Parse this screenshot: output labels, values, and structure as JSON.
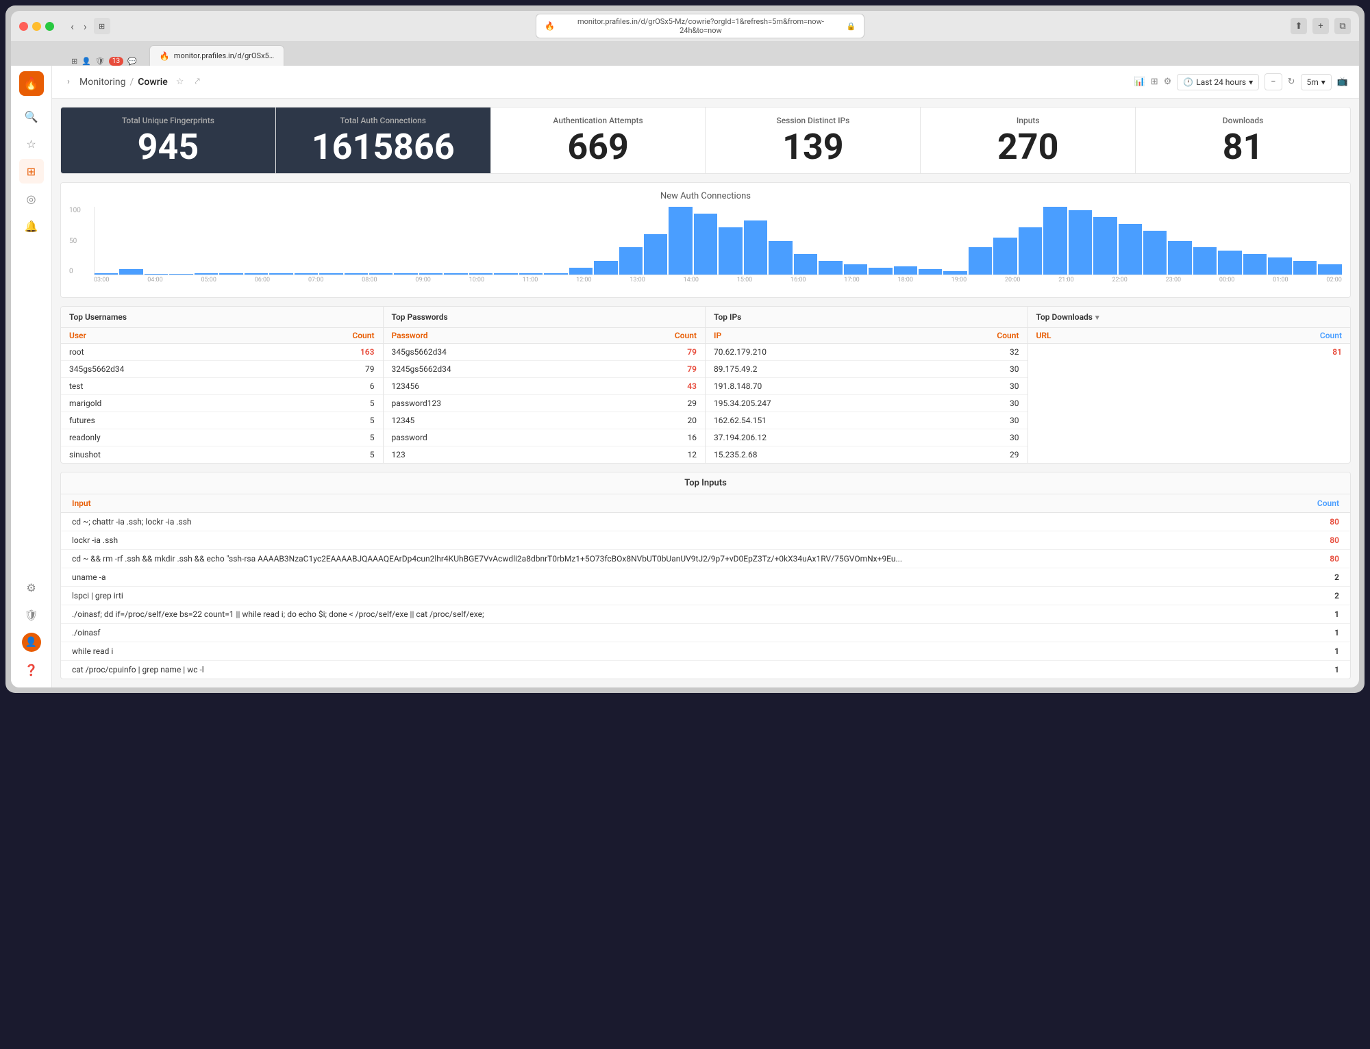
{
  "window": {
    "title": "monitor.prafiles.in/d/grOSx5-Mz/cowrie?orgId=1&refresh=5m&from=now-24h&to=now",
    "tab_badge": "13"
  },
  "header": {
    "breadcrumb_root": "Monitoring",
    "breadcrumb_current": "Cowrie",
    "time_range": "Last 24 hours",
    "refresh_interval": "5m",
    "chevron": "▾",
    "zoom_in": "−",
    "zoom_out": "⊕"
  },
  "stats": [
    {
      "label": "Total Unique Fingerprints",
      "value": "945",
      "dark": true
    },
    {
      "label": "Total Auth Connections",
      "value": "1615866",
      "dark": true
    },
    {
      "label": "Authentication Attempts",
      "value": "669",
      "dark": false
    },
    {
      "label": "Session Distinct IPs",
      "value": "139",
      "dark": false
    },
    {
      "label": "Inputs",
      "value": "270",
      "dark": false
    },
    {
      "label": "Downloads",
      "value": "81",
      "dark": false
    }
  ],
  "chart": {
    "title": "New Auth Connections",
    "y_labels": [
      "100",
      "50",
      "0"
    ],
    "x_labels": [
      "03:00",
      "04:00",
      "05:00",
      "06:00",
      "07:00",
      "08:00",
      "09:00",
      "10:00",
      "11:00",
      "12:00",
      "13:00",
      "14:00",
      "15:00",
      "16:00",
      "17:00",
      "18:00",
      "19:00",
      "20:00",
      "21:00",
      "22:00",
      "23:00",
      "00:00",
      "01:00",
      "02:00"
    ],
    "bars": [
      2,
      8,
      1,
      1,
      2,
      2,
      2,
      2,
      2,
      2,
      2,
      2,
      2,
      2,
      2,
      2,
      2,
      2,
      2,
      10,
      20,
      40,
      60,
      100,
      90,
      70,
      80,
      50,
      30,
      20,
      15,
      10,
      12,
      8,
      5,
      40,
      55,
      70,
      100,
      95,
      85,
      75,
      65,
      50,
      40,
      35,
      30,
      25,
      20,
      15
    ]
  },
  "top_usernames": {
    "title": "Top Usernames",
    "col_user": "User",
    "col_count": "Count",
    "rows": [
      {
        "user": "root",
        "count": "163",
        "highlight": true
      },
      {
        "user": "345gs5662d34",
        "count": "79",
        "highlight": false
      },
      {
        "user": "test",
        "count": "6",
        "highlight": false
      },
      {
        "user": "marigold",
        "count": "5",
        "highlight": false
      },
      {
        "user": "futures",
        "count": "5",
        "highlight": false
      },
      {
        "user": "readonly",
        "count": "5",
        "highlight": false
      },
      {
        "user": "sinushot",
        "count": "5",
        "highlight": false
      }
    ]
  },
  "top_passwords": {
    "title": "Top Passwords",
    "col_password": "Password",
    "col_count": "Count",
    "rows": [
      {
        "password": "345gs5662d34",
        "count": "79",
        "highlight": true
      },
      {
        "password": "3245gs5662d34",
        "count": "79",
        "highlight": true
      },
      {
        "password": "123456",
        "count": "43",
        "highlight": true
      },
      {
        "password": "password123",
        "count": "29",
        "highlight": false
      },
      {
        "password": "12345",
        "count": "20",
        "highlight": false
      },
      {
        "password": "password",
        "count": "16",
        "highlight": false
      },
      {
        "password": "123",
        "count": "12",
        "highlight": false
      }
    ]
  },
  "top_ips": {
    "title": "Top IPs",
    "col_ip": "IP",
    "col_count": "Count",
    "rows": [
      {
        "ip": "70.62.179.210",
        "count": "32",
        "highlight": false
      },
      {
        "ip": "89.175.49.2",
        "count": "30",
        "highlight": false
      },
      {
        "ip": "191.8.148.70",
        "count": "30",
        "highlight": false
      },
      {
        "ip": "195.34.205.247",
        "count": "30",
        "highlight": false
      },
      {
        "ip": "162.62.54.151",
        "count": "30",
        "highlight": false
      },
      {
        "ip": "37.194.206.12",
        "count": "30",
        "highlight": false
      },
      {
        "ip": "15.235.2.68",
        "count": "29",
        "highlight": false
      }
    ]
  },
  "top_downloads": {
    "title": "Top Downloads",
    "col_url": "URL",
    "col_count": "Count",
    "rows": [
      {
        "url": "",
        "count": "81",
        "highlight": true
      }
    ]
  },
  "top_inputs": {
    "title": "Top Inputs",
    "col_input": "Input",
    "col_count": "Count",
    "rows": [
      {
        "input": "cd ~; chattr -ia .ssh; lockr -ia .ssh",
        "count": "80",
        "highlight": true
      },
      {
        "input": "lockr -ia .ssh",
        "count": "80",
        "highlight": true
      },
      {
        "input": "cd ~ && rm -rf .ssh && mkdir .ssh && echo \"ssh-rsa AAAAB3NzaC1yc2EAAAABJQAAAQEArDp4cun2lhr4KUhBGE7VvAcwdli2a8dbnrT0rbMz1+5O73fcBOx8NVbUT0bUanUV9tJ2/9p7+vD0EpZ3Tz/+0kX34uAx1RV/75GVOmNx+9Eu...",
        "count": "80",
        "highlight": true
      },
      {
        "input": "uname -a",
        "count": "2",
        "highlight": false
      },
      {
        "input": "lspci | grep irti",
        "count": "2",
        "highlight": false
      },
      {
        "input": "./oinasf; dd if=/proc/self/exe bs=22 count=1 || while read i; do echo $i; done < /proc/self/exe || cat /proc/self/exe;",
        "count": "1",
        "highlight": false
      },
      {
        "input": "./oinasf",
        "count": "1",
        "highlight": false
      },
      {
        "input": "while read i",
        "count": "1",
        "highlight": false
      },
      {
        "input": "cat /proc/cpuinfo | grep name | wc -l",
        "count": "1",
        "highlight": false
      }
    ]
  },
  "sidebar": {
    "items": [
      "🔍",
      "☆",
      "⊞",
      "◎",
      "🔔",
      "⚙",
      "🛡",
      "👤",
      "❓"
    ]
  }
}
